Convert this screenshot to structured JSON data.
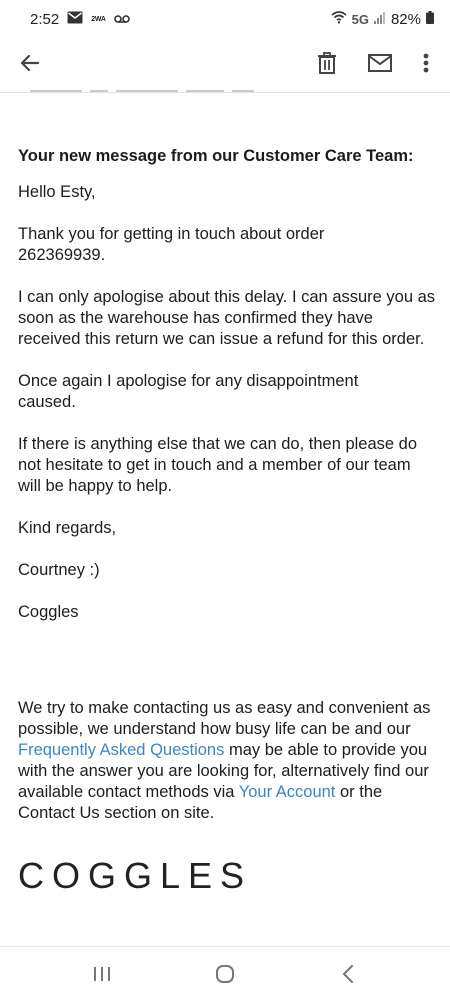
{
  "status_bar": {
    "time": "2:52",
    "mini_label": "2WA",
    "network": "5G",
    "battery": "82%"
  },
  "toolbar": {
    "icons": [
      "back-arrow-icon",
      "trash-icon",
      "mail-icon",
      "more-vert-icon"
    ]
  },
  "email": {
    "heading": "Your new message from our Customer Care Team:",
    "greeting": "Hello Esty,",
    "para1": "Thank you for getting in touch about order 262369939.",
    "para2": "I can only apologise about this delay. I can assure you as soon as the warehouse has confirmed they have received this return we can issue a refund for this order.",
    "para3": "Once again I apologise for any disappointment caused.",
    "para4": "If there is anything else that we can do, then please do not hesitate to get in touch and a member of our team will be happy to help.",
    "closing": "Kind regards,",
    "signature": "Courtney :)",
    "company": "Coggles",
    "footer": {
      "part1": "We try to make contacting us as easy and convenient as possible, we understand how busy life can be and our ",
      "link1": "Frequently Asked Questions",
      "part2": " may be able to provide you with the answer you are looking for, alternatively find our available contact methods via ",
      "link2": "Your Account",
      "part3": " or the Contact Us section on site."
    },
    "logo": "COGGLES"
  },
  "nav_bar": {
    "icons": [
      "recent-apps-icon",
      "home-icon",
      "back-icon"
    ]
  },
  "colors": {
    "link": "#3c86c7",
    "text": "#1d1d1d"
  }
}
